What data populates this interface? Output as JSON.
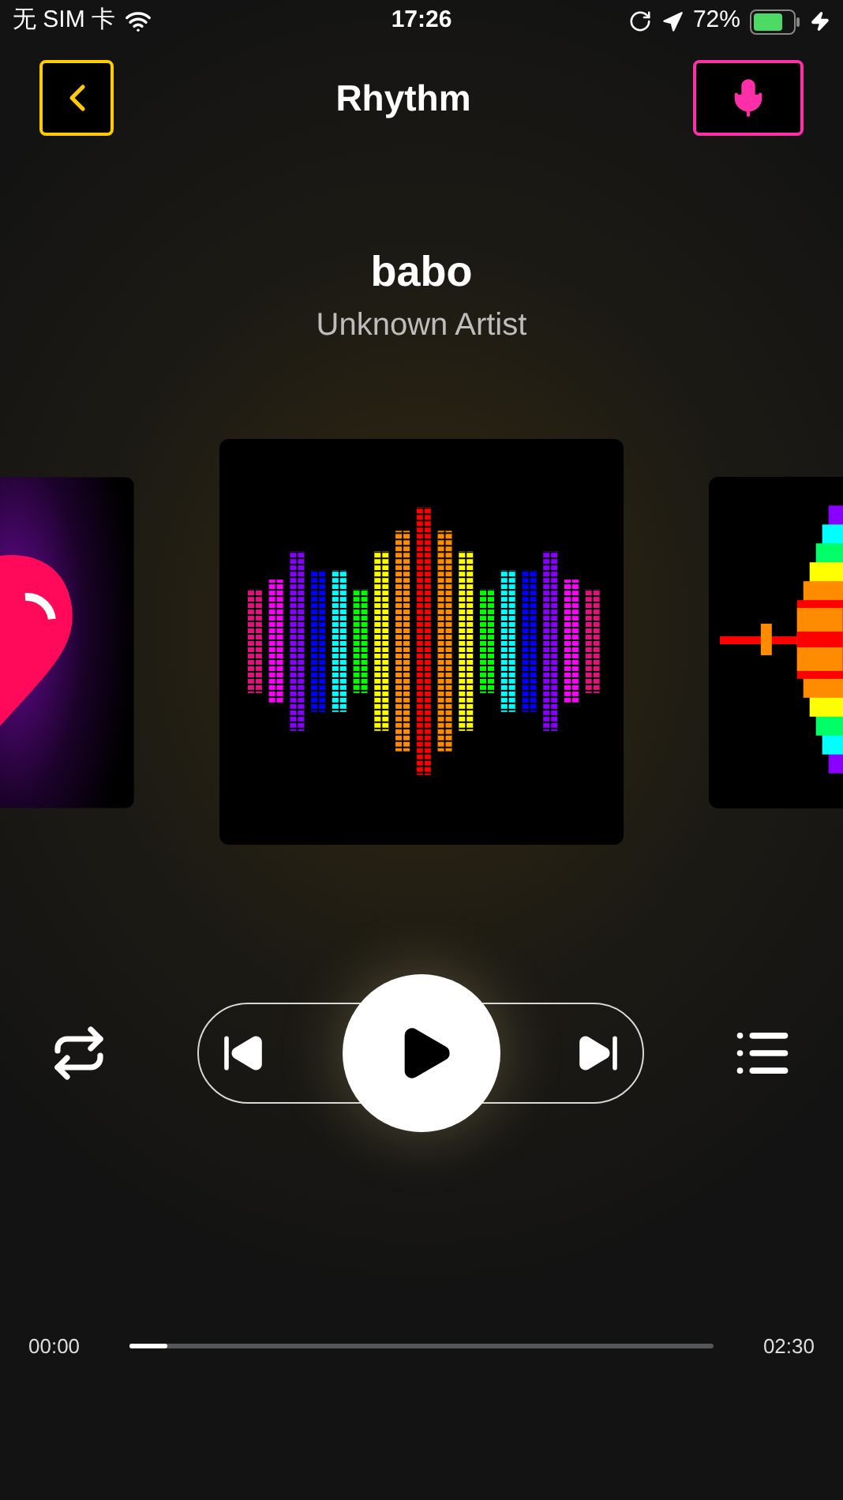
{
  "status_bar": {
    "carrier": "无 SIM 卡",
    "time": "17:26",
    "battery_text": "72%"
  },
  "header": {
    "title": "Rhythm"
  },
  "track": {
    "title": "babo",
    "artist": "Unknown Artist"
  },
  "carousel": [
    {
      "kind": "heart"
    },
    {
      "kind": "equalizer"
    },
    {
      "kind": "spectrum"
    }
  ],
  "player": {
    "playing": false
  },
  "progress": {
    "elapsed": "00:00",
    "total": "02:30",
    "level": 0.066
  }
}
